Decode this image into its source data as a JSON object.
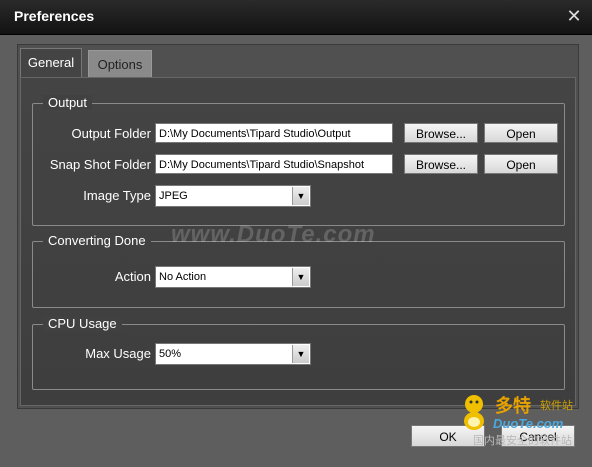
{
  "window": {
    "title": "Preferences",
    "close_glyph": "✕"
  },
  "tabs": [
    {
      "label": "General",
      "active": true
    },
    {
      "label": "Options",
      "active": false
    }
  ],
  "output": {
    "legend": "Output",
    "output_folder": {
      "label": "Output Folder",
      "value": "D:\\My Documents\\Tipard Studio\\Output",
      "browse": "Browse...",
      "open": "Open"
    },
    "snapshot_folder": {
      "label": "Snap Shot Folder",
      "value": "D:\\My Documents\\Tipard Studio\\Snapshot",
      "browse": "Browse...",
      "open": "Open"
    },
    "image_type": {
      "label": "Image Type",
      "value": "JPEG"
    }
  },
  "converting_done": {
    "legend": "Converting Done",
    "action": {
      "label": "Action",
      "value": "No Action"
    }
  },
  "cpu_usage": {
    "legend": "CPU Usage",
    "max_usage": {
      "label": "Max Usage",
      "value": "50%"
    }
  },
  "footer": {
    "ok": "OK",
    "cancel": "Cancel"
  },
  "watermark": {
    "text": "www.DuoTe.com",
    "logo_line1": "多特",
    "logo_line2": "软件站",
    "logo_line3": "DuoTe.com",
    "logo_line4": "国内最安全的软件站"
  },
  "colors": {
    "background": "#5e5e5e",
    "titlebar": "#121212",
    "logo_orange": "#e8a200",
    "logo_blue": "#4aa8e0"
  },
  "icons": {
    "close": "close-icon",
    "dropdown": "chevron-down-icon"
  }
}
